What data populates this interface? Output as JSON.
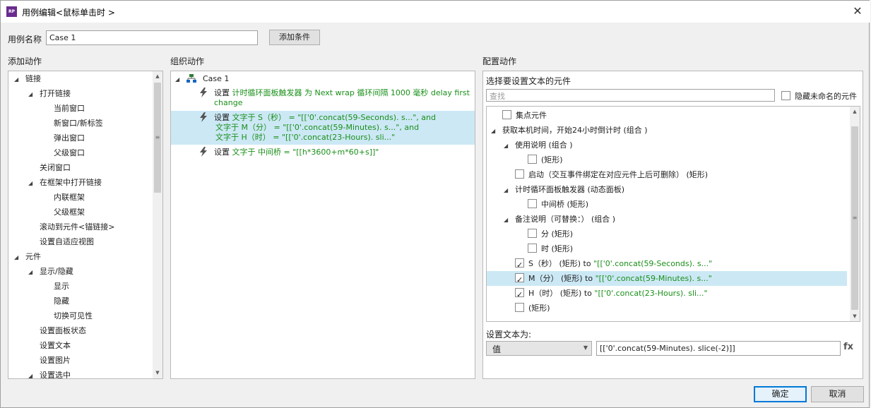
{
  "window": {
    "title": "用例编辑<鼠标单击时 >",
    "app_icon_text": "RP",
    "close_glyph": "✕"
  },
  "case": {
    "name_label": "用例名称",
    "name_value": "Case 1",
    "add_condition_label": "添加条件"
  },
  "columns": {
    "add_action": "添加动作",
    "organize_action": "组织动作",
    "configure_action": "配置动作"
  },
  "add_action_tree": [
    {
      "label": "链接",
      "level": 0,
      "expandable": true
    },
    {
      "label": "打开链接",
      "level": 1,
      "expandable": true
    },
    {
      "label": "当前窗口",
      "level": 2,
      "expandable": false
    },
    {
      "label": "新窗口/新标签",
      "level": 2,
      "expandable": false
    },
    {
      "label": "弹出窗口",
      "level": 2,
      "expandable": false
    },
    {
      "label": "父级窗口",
      "level": 2,
      "expandable": false
    },
    {
      "label": "关闭窗口",
      "level": 1,
      "expandable": false
    },
    {
      "label": "在框架中打开链接",
      "level": 1,
      "expandable": true
    },
    {
      "label": "内联框架",
      "level": 2,
      "expandable": false
    },
    {
      "label": "父级框架",
      "level": 2,
      "expandable": false
    },
    {
      "label": "滚动到元件<锚链接>",
      "level": 1,
      "expandable": false
    },
    {
      "label": "设置自适应视图",
      "level": 1,
      "expandable": false
    },
    {
      "label": "元件",
      "level": 0,
      "expandable": true
    },
    {
      "label": "显示/隐藏",
      "level": 1,
      "expandable": true
    },
    {
      "label": "显示",
      "level": 2,
      "expandable": false
    },
    {
      "label": "隐藏",
      "level": 2,
      "expandable": false
    },
    {
      "label": "切换可见性",
      "level": 2,
      "expandable": false
    },
    {
      "label": "设置面板状态",
      "level": 1,
      "expandable": false
    },
    {
      "label": "设置文本",
      "level": 1,
      "expandable": false
    },
    {
      "label": "设置图片",
      "level": 1,
      "expandable": false
    },
    {
      "label": "设置选中",
      "level": 1,
      "expandable": true
    }
  ],
  "organize": {
    "case_label": "Case 1",
    "actions": [
      {
        "prefix": "设置",
        "lines": [
          "计时循环面板触发器 为 Next wrap 循环间隔 1000 毫秒 delay first",
          "change"
        ],
        "selected": false
      },
      {
        "prefix": "设置",
        "lines": [
          "文字于 S（秒） = \"[['0'.concat(59-Seconds). s...\", and",
          "文字于 M（分） = \"[['0'.concat(59-Minutes). s...\", and",
          "文字于 H（时） = \"[['0'.concat(23-Hours). sli...\""
        ],
        "selected": true
      },
      {
        "prefix": "设置",
        "lines": [
          "文字于 中间桥 = \"[[h*3600+m*60+s]]\""
        ],
        "selected": false
      }
    ]
  },
  "configure": {
    "select_elements_label": "选择要设置文本的元件",
    "search_placeholder": "查找",
    "hide_unnamed_label": "隐藏未命名的元件",
    "elements": [
      {
        "label": "集点元件",
        "level": 0,
        "checkbox": true,
        "checked": false,
        "expandable": false,
        "assign": ""
      },
      {
        "label": "获取本机时间，开始24小时倒计时 (组合 )",
        "level": 0,
        "checkbox": false,
        "checked": false,
        "expandable": true,
        "assign": ""
      },
      {
        "label": "使用说明 (组合 )",
        "level": 1,
        "checkbox": false,
        "checked": false,
        "expandable": true,
        "assign": ""
      },
      {
        "label": "(矩形)",
        "level": 2,
        "checkbox": true,
        "checked": false,
        "expandable": false,
        "assign": ""
      },
      {
        "label": "启动（交互事件绑定在对应元件上后可删除） (矩形)",
        "level": 1,
        "checkbox": true,
        "checked": false,
        "expandable": false,
        "assign": ""
      },
      {
        "label": "计时循环面板触发器 (动态面板)",
        "level": 1,
        "checkbox": false,
        "checked": false,
        "expandable": true,
        "assign": ""
      },
      {
        "label": "中间桥 (矩形)",
        "level": 2,
        "checkbox": true,
        "checked": false,
        "expandable": false,
        "assign": ""
      },
      {
        "label": "备注说明（可替换：） (组合 )",
        "level": 1,
        "checkbox": false,
        "checked": false,
        "expandable": true,
        "assign": ""
      },
      {
        "label": "分 (矩形)",
        "level": 2,
        "checkbox": true,
        "checked": false,
        "expandable": false,
        "assign": ""
      },
      {
        "label": "时 (矩形)",
        "level": 2,
        "checkbox": true,
        "checked": false,
        "expandable": false,
        "assign": ""
      },
      {
        "label": "S（秒） (矩形)",
        "level": 1,
        "checkbox": true,
        "checked": true,
        "expandable": false,
        "assign": " to \"[['0'.concat(59-Seconds). s...\""
      },
      {
        "label": "M（分） (矩形)",
        "level": 1,
        "checkbox": true,
        "checked": true,
        "expandable": false,
        "assign": " to \"[['0'.concat(59-Minutes). s...\"",
        "selected": true
      },
      {
        "label": "H（时） (矩形)",
        "level": 1,
        "checkbox": true,
        "checked": true,
        "expandable": false,
        "assign": " to \"[['0'.concat(23-Hours). sli...\""
      },
      {
        "label": "(矩形)",
        "level": 1,
        "checkbox": true,
        "checked": false,
        "expandable": false,
        "assign": ""
      }
    ],
    "set_text_label": "设置文本为:",
    "value_type": "值",
    "expression": "[['0'.concat(59-Minutes). slice(-2)]]",
    "fx_label": "fx"
  },
  "footer": {
    "ok_label": "确定",
    "cancel_label": "取消"
  }
}
